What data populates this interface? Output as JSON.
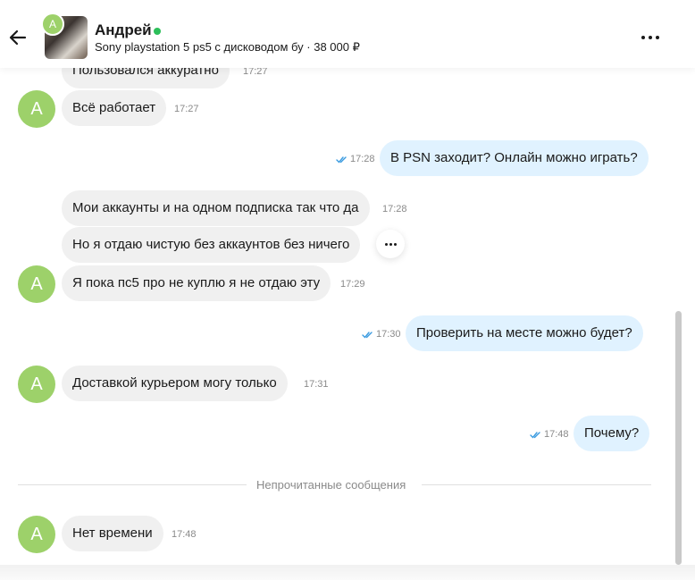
{
  "header": {
    "contact_name": "Андрей",
    "avatar_letter": "А",
    "listing": "Sony playstation 5 ps5 с дисководом бу · 38 000 ₽"
  },
  "messages": [
    {
      "dir": "in",
      "text": "Пользовался аккуратно",
      "time": "17:27"
    },
    {
      "dir": "in",
      "text": "Всё работает",
      "time": "17:27",
      "avatar": "А"
    },
    {
      "dir": "out",
      "text": "В PSN заходит? Онлайн можно играть?",
      "time": "17:28",
      "read": true
    },
    {
      "dir": "in",
      "text": "Мои аккаунты и на одном подписка так что да",
      "time": "17:28"
    },
    {
      "dir": "in",
      "text": "Но я отдаю чистую без аккаунтов без ничего",
      "time": ""
    },
    {
      "dir": "in",
      "text": "Я пока пс5 про не куплю я не отдаю эту",
      "time": "17:29",
      "avatar": "А"
    },
    {
      "dir": "out",
      "text": "Проверить на месте можно будет?",
      "time": "17:30",
      "read": true
    },
    {
      "dir": "in",
      "text": "Доставкой курьером могу только",
      "time": "17:31",
      "avatar": "А"
    },
    {
      "dir": "out",
      "text": "Почему?",
      "time": "17:48",
      "read": true
    },
    {
      "dir": "in",
      "text": "Нет времени",
      "time": "17:48",
      "avatar": "А"
    }
  ],
  "divider": {
    "label": "Непрочитанные сообщения"
  },
  "colors": {
    "online": "#2dbf5a",
    "avatar": "#9dd16a",
    "incoming_bubble": "#f0f0f0",
    "outgoing_bubble": "#e0f2ff",
    "read_ticks": "#3a9be0"
  }
}
